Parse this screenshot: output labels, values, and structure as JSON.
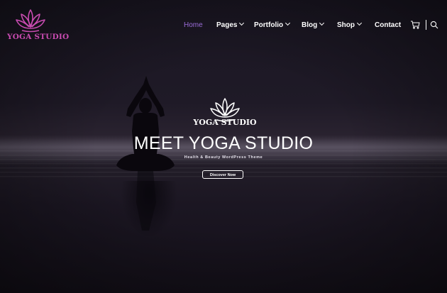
{
  "brand": {
    "logo_text": "YOGA STUDIO",
    "logo_color": "#c84bb0",
    "logo_icon": "lotus-icon"
  },
  "nav": {
    "items": [
      {
        "label": "Home",
        "active": true,
        "has_dropdown": false
      },
      {
        "label": "Pages",
        "active": false,
        "has_dropdown": true
      },
      {
        "label": "Portfolio",
        "active": false,
        "has_dropdown": true
      },
      {
        "label": "Blog",
        "active": false,
        "has_dropdown": true
      },
      {
        "label": "Shop",
        "active": false,
        "has_dropdown": true
      },
      {
        "label": "Contact",
        "active": false,
        "has_dropdown": false
      }
    ],
    "active_color": "#9b6cd8",
    "cart_icon": "cart-icon",
    "search_icon": "search-icon"
  },
  "hero": {
    "emblem_text": "YOGA STUDIO",
    "emblem_icon": "lotus-icon",
    "title": "MEET YOGA STUDIO",
    "subtitle": "Health & Beauty WordPress Theme",
    "button_label": "Discover Now"
  }
}
